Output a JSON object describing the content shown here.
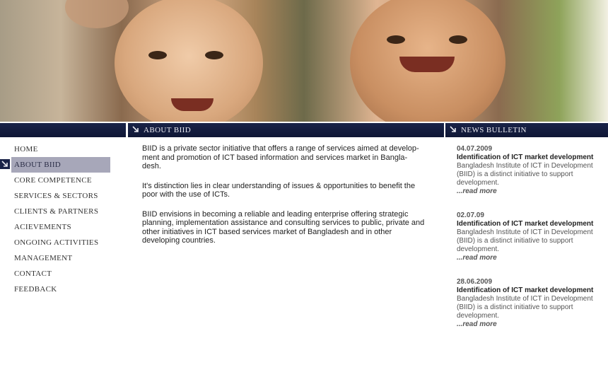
{
  "bars": {
    "about": "ABOUT BIID",
    "news": "NEWS BULLETIN"
  },
  "sidebar": {
    "items": [
      {
        "label": "HOME"
      },
      {
        "label": "ABOUT BIID",
        "active": true
      },
      {
        "label": "CORE COMPETENCE"
      },
      {
        "label": "SERVICES & SECTORS"
      },
      {
        "label": "CLIENTS & PARTNERS"
      },
      {
        "label": "ACIEVEMENTS"
      },
      {
        "label": "ONGOING ACTIVITIES"
      },
      {
        "label": "MANAGEMENT"
      },
      {
        "label": "CONTACT"
      },
      {
        "label": "FEEDBACK"
      }
    ]
  },
  "main": {
    "paragraphs": [
      "BIID is a private sector initiative that offers a range of  services aimed at develop-ment and promotion of ICT based information and services market in Bangla-desh.",
      "It's distinction lies in clear understanding of issues & opportunities to  benefit the poor with the use of ICTs.",
      "BIID envisions in becoming a reliable and leading  enterprise offering  strategic planning, implementation assistance and consulting services to public, private and other initiatives in ICT based services  market of Bangladesh and in other developing countries."
    ]
  },
  "news": {
    "items": [
      {
        "date": "04.07.2009",
        "title": "Identification of ICT market development",
        "text": "Bangladesh Institute of ICT in Development (BIID) is a distinct initiative to support development.",
        "more": "...read more"
      },
      {
        "date": "02.07.09",
        "title": "Identification of ICT market development",
        "text": "Bangladesh Institute of ICT in Development (BIID) is a distinct initiative to support development.",
        "more": "...read more"
      },
      {
        "date": "28.06.2009",
        "title": "Identification of ICT market development",
        "text": "Bangladesh Institute of ICT in Development (BIID) is a distinct initiative to support development.",
        "more": "...read more"
      }
    ]
  },
  "colors": {
    "bar": "#1a2348",
    "active_nav": "#a7a7b9"
  }
}
